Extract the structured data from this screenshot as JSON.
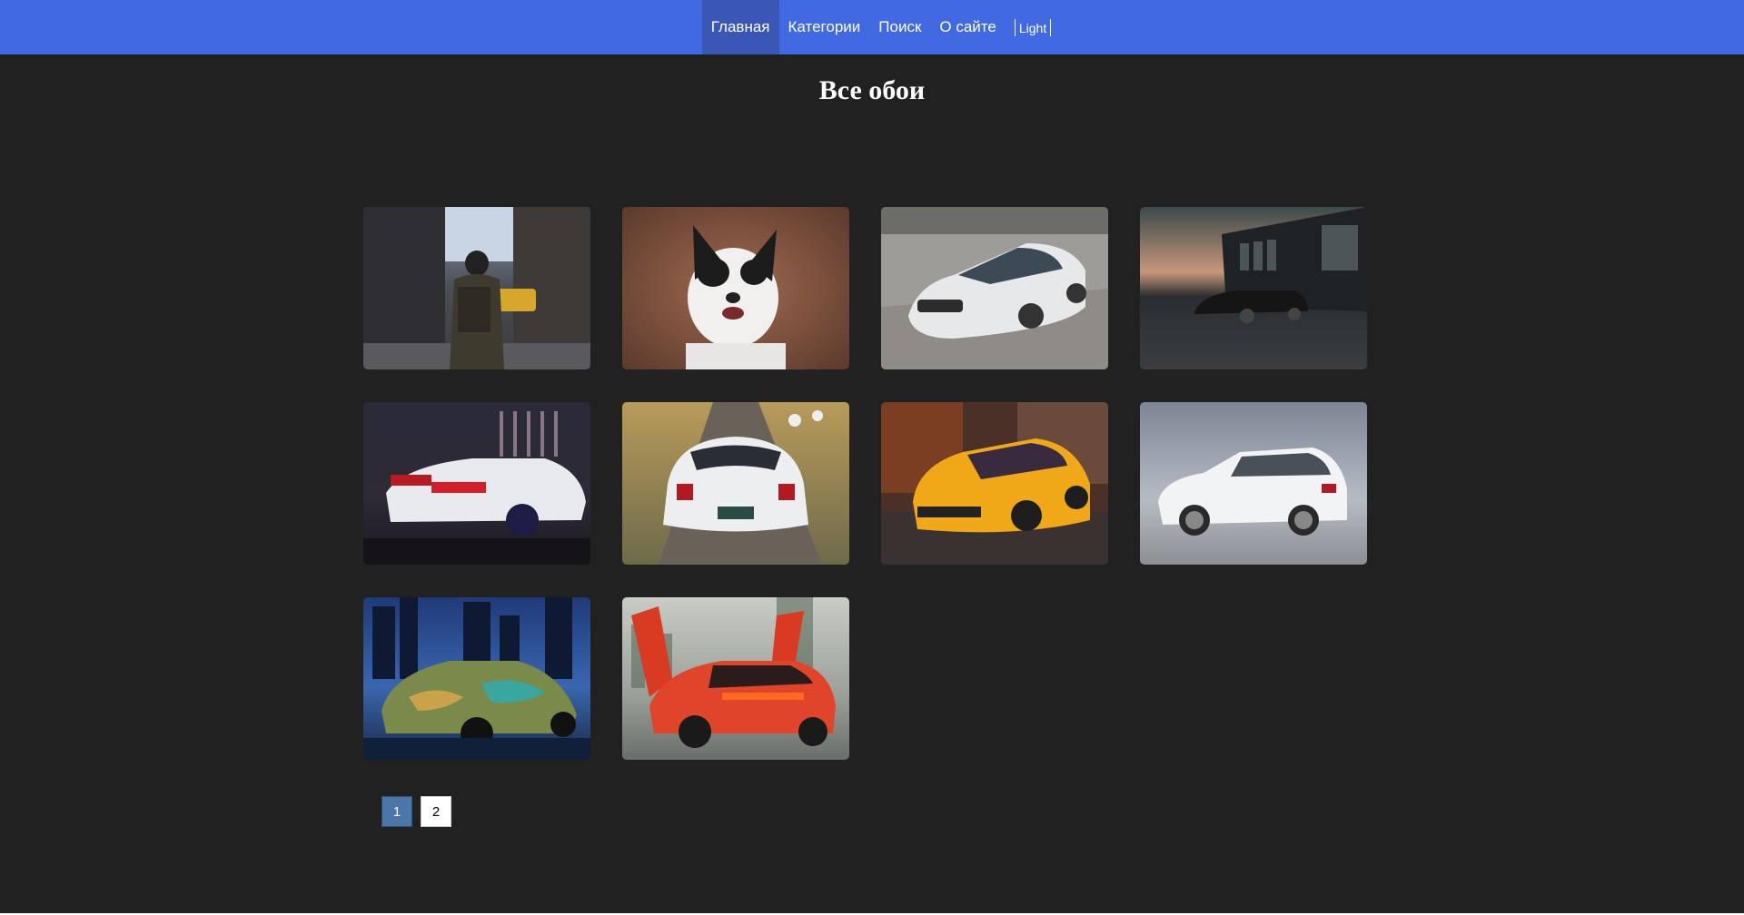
{
  "nav": {
    "items": [
      {
        "label": "Главная",
        "active": true
      },
      {
        "label": "Категории",
        "active": false
      },
      {
        "label": "Поиск",
        "active": false
      },
      {
        "label": "О сайте",
        "active": false
      }
    ],
    "theme_toggle": "Light"
  },
  "page_title": "Все обои",
  "gallery": {
    "items": [
      {
        "subject": "city street ruins with soldier"
      },
      {
        "subject": "black and white dog"
      },
      {
        "subject": "white BMW M3"
      },
      {
        "subject": "dark BMW by hangar"
      },
      {
        "subject": "white Ford Mustang at night"
      },
      {
        "subject": "white Nissan 370Z rear"
      },
      {
        "subject": "yellow Volkswagen Golf"
      },
      {
        "subject": "white Volkswagen Golf"
      },
      {
        "subject": "camo Mercedes drift car"
      },
      {
        "subject": "orange Lamborghini Aventador"
      }
    ]
  },
  "pagination": {
    "pages": [
      "1",
      "2"
    ],
    "current": "1"
  },
  "colors": {
    "navbar": "#4169e1",
    "background": "#212121",
    "current_page": "#4a76a8"
  }
}
